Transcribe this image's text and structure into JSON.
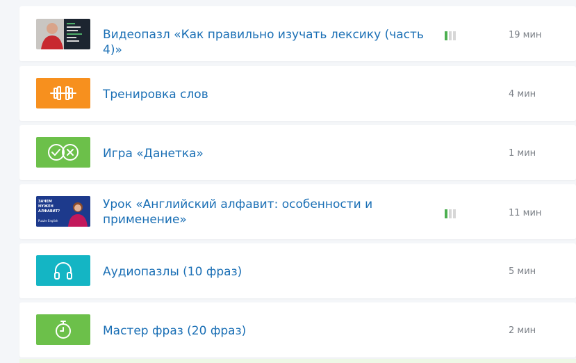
{
  "lessons": [
    {
      "title": "Видеопазл «Как правильно изучать лексику (часть 4)»",
      "duration": "19 мин",
      "icon": "video-thumbnail",
      "has_level": true,
      "level": 1,
      "level_max": 3
    },
    {
      "title": "Тренировка слов",
      "duration": "4 мин",
      "icon": "dumbbell-icon",
      "color": "#f7901e"
    },
    {
      "title": "Игра «Данетка»",
      "duration": "1 мин",
      "icon": "check-cross-icon",
      "color": "#6cc04a"
    },
    {
      "title": "Урок «Английский алфавит: особенности и применение»",
      "duration": "11 мин",
      "icon": "lesson-thumbnail",
      "has_level": true,
      "level": 1,
      "level_max": 3,
      "thumb_text": "ЗАЧЕМ НУЖЕН АЛФАВИТ?",
      "thumb_brand": "Puzzle English"
    },
    {
      "title": "Аудиопазлы (10 фраз)",
      "duration": "5 мин",
      "icon": "headphones-icon",
      "color": "#14b5c4"
    },
    {
      "title": "Мастер фраз (20 фраз)",
      "duration": "2 мин",
      "icon": "stopwatch-icon",
      "color": "#6cc04a"
    }
  ],
  "colors": {
    "link": "#1a6fb5",
    "muted": "#7a7f86",
    "level_on": "#4caf50",
    "level_off": "#d7d7d7"
  }
}
